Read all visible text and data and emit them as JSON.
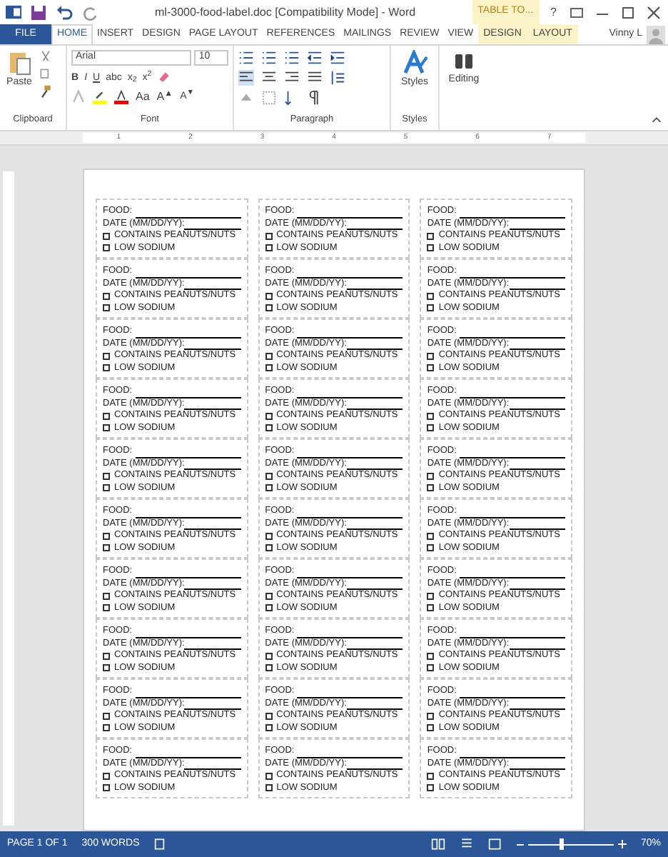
{
  "title_bar": {
    "title": "ml-3000-food-label.doc [Compatibility Mode] - Word",
    "contextual_group": "TABLE TO...",
    "help": "?"
  },
  "tabs": [
    {
      "label": "FILE",
      "kind": "file",
      "selected": false
    },
    {
      "label": "HOME",
      "kind": "normal",
      "selected": true
    },
    {
      "label": "INSERT",
      "kind": "normal",
      "selected": false
    },
    {
      "label": "DESIGN",
      "kind": "normal",
      "selected": false
    },
    {
      "label": "PAGE LAYOUT",
      "kind": "normal",
      "selected": false
    },
    {
      "label": "REFERENCES",
      "kind": "normal",
      "selected": false
    },
    {
      "label": "MAILINGS",
      "kind": "normal",
      "selected": false
    },
    {
      "label": "REVIEW",
      "kind": "normal",
      "selected": false
    },
    {
      "label": "VIEW",
      "kind": "normal",
      "selected": false
    },
    {
      "label": "DESIGN",
      "kind": "contextual",
      "selected": false
    },
    {
      "label": "LAYOUT",
      "kind": "contextual",
      "selected": false
    }
  ],
  "user": "Vinny L",
  "ribbon": {
    "paste": "Paste",
    "clipboard_label": "Clipboard",
    "font_name": "Arial",
    "font_size": "10",
    "font_buttons": [
      "B",
      "I",
      "U",
      "abc",
      "x$_{2}$",
      "x$^{2}$"
    ],
    "case_button": "Aa",
    "grow_button": "A$^{▲}$",
    "shrink_button": "A$^{▼}$",
    "font_label": "Font",
    "paragraph_label": "Paragraph",
    "styles": "Styles",
    "styles_label": "Styles",
    "editing": "Editing"
  },
  "ruler": [
    "1",
    "2",
    "3",
    "4",
    "5",
    "6",
    "7"
  ],
  "label_rows": [
    [
      {
        "food": "FOOD:",
        "date": "DATE (MM/DD/YY):",
        "options": [
          {
            "text": "CONTAINS PEANUTS/NUTS",
            "checked": false
          },
          {
            "text": "LOW SODIUM",
            "checked": false
          }
        ]
      },
      {
        "food": "FOOD:",
        "date": "DATE (MM/DD/YY):",
        "options": [
          {
            "text": "CONTAINS PEANUTS/NUTS",
            "checked": false
          },
          {
            "text": "LOW SODIUM",
            "checked": false
          }
        ]
      },
      {
        "food": "FOOD:",
        "date": "DATE (MM/DD/YY):",
        "options": [
          {
            "text": "CONTAINS PEANUTS/NUTS",
            "checked": false
          },
          {
            "text": "LOW SODIUM",
            "checked": false
          }
        ]
      }
    ],
    [
      {
        "food": "FOOD:",
        "date": "DATE (MM/DD/YY):",
        "options": [
          {
            "text": "CONTAINS PEANUTS/NUTS",
            "checked": false
          },
          {
            "text": "LOW SODIUM",
            "checked": false
          }
        ]
      },
      {
        "food": "FOOD:",
        "date": "DATE (MM/DD/YY):",
        "options": [
          {
            "text": "CONTAINS PEANUTS/NUTS",
            "checked": false
          },
          {
            "text": "LOW SODIUM",
            "checked": false
          }
        ]
      },
      {
        "food": "FOOD:",
        "date": "DATE (MM/DD/YY):",
        "options": [
          {
            "text": "CONTAINS PEANUTS/NUTS",
            "checked": false
          },
          {
            "text": "LOW SODIUM",
            "checked": false
          }
        ]
      }
    ],
    [
      {
        "food": "FOOD:",
        "date": "DATE (MM/DD/YY):",
        "options": [
          {
            "text": "CONTAINS PEANUTS/NUTS",
            "checked": false
          },
          {
            "text": "LOW SODIUM",
            "checked": false
          }
        ]
      },
      {
        "food": "FOOD:",
        "date": "DATE (MM/DD/YY):",
        "options": [
          {
            "text": "CONTAINS PEANUTS/NUTS",
            "checked": false
          },
          {
            "text": "LOW SODIUM",
            "checked": false
          }
        ]
      },
      {
        "food": "FOOD:",
        "date": "DATE (MM/DD/YY):",
        "options": [
          {
            "text": "CONTAINS PEANUTS/NUTS",
            "checked": false
          },
          {
            "text": "LOW SODIUM",
            "checked": false
          }
        ]
      }
    ],
    [
      {
        "food": "FOOD:",
        "date": "DATE (MM/DD/YY):",
        "options": [
          {
            "text": "CONTAINS PEANUTS/NUTS",
            "checked": false
          },
          {
            "text": "LOW SODIUM",
            "checked": false
          }
        ]
      },
      {
        "food": "FOOD:",
        "date": "DATE (MM/DD/YY):",
        "options": [
          {
            "text": "CONTAINS PEANUTS/NUTS",
            "checked": false
          },
          {
            "text": "LOW SODIUM",
            "checked": false
          }
        ]
      },
      {
        "food": "FOOD:",
        "date": "DATE (MM/DD/YY):",
        "options": [
          {
            "text": "CONTAINS PEANUTS/NUTS",
            "checked": false
          },
          {
            "text": "LOW SODIUM",
            "checked": false
          }
        ]
      }
    ],
    [
      {
        "food": "FOOD:",
        "date": "DATE (MM/DD/YY):",
        "options": [
          {
            "text": "CONTAINS PEANUTS/NUTS",
            "checked": false
          },
          {
            "text": "LOW SODIUM",
            "checked": false
          }
        ]
      },
      {
        "food": "FOOD:",
        "date": "DATE (MM/DD/YY):",
        "options": [
          {
            "text": "CONTAINS PEANUTS/NUTS",
            "checked": false
          },
          {
            "text": "LOW SODIUM",
            "checked": false
          }
        ]
      },
      {
        "food": "FOOD:",
        "date": "DATE (MM/DD/YY):",
        "options": [
          {
            "text": "CONTAINS PEANUTS/NUTS",
            "checked": false
          },
          {
            "text": "LOW SODIUM",
            "checked": false
          }
        ]
      }
    ],
    [
      {
        "food": "FOOD:",
        "date": "DATE (MM/DD/YY):",
        "options": [
          {
            "text": "CONTAINS PEANUTS/NUTS",
            "checked": false
          },
          {
            "text": "LOW SODIUM",
            "checked": false
          }
        ]
      },
      {
        "food": "FOOD:",
        "date": "DATE (MM/DD/YY):",
        "options": [
          {
            "text": "CONTAINS PEANUTS/NUTS",
            "checked": false
          },
          {
            "text": "LOW SODIUM",
            "checked": false
          }
        ]
      },
      {
        "food": "FOOD:",
        "date": "DATE (MM/DD/YY):",
        "options": [
          {
            "text": "CONTAINS PEANUTS/NUTS",
            "checked": false
          },
          {
            "text": "LOW SODIUM",
            "checked": false
          }
        ]
      }
    ],
    [
      {
        "food": "FOOD:",
        "date": "DATE (MM/DD/YY):",
        "options": [
          {
            "text": "CONTAINS PEANUTS/NUTS",
            "checked": false
          },
          {
            "text": "LOW SODIUM",
            "checked": false
          }
        ]
      },
      {
        "food": "FOOD:",
        "date": "DATE (MM/DD/YY):",
        "options": [
          {
            "text": "CONTAINS PEANUTS/NUTS",
            "checked": false
          },
          {
            "text": "LOW SODIUM",
            "checked": false
          }
        ]
      },
      {
        "food": "FOOD:",
        "date": "DATE (MM/DD/YY):",
        "options": [
          {
            "text": "CONTAINS PEANUTS/NUTS",
            "checked": false
          },
          {
            "text": "LOW SODIUM",
            "checked": false
          }
        ]
      }
    ],
    [
      {
        "food": "FOOD:",
        "date": "DATE (MM/DD/YY):",
        "options": [
          {
            "text": "CONTAINS PEANUTS/NUTS",
            "checked": false
          },
          {
            "text": "LOW SODIUM",
            "checked": false
          }
        ]
      },
      {
        "food": "FOOD:",
        "date": "DATE (MM/DD/YY):",
        "options": [
          {
            "text": "CONTAINS PEANUTS/NUTS",
            "checked": false
          },
          {
            "text": "LOW SODIUM",
            "checked": false
          }
        ]
      },
      {
        "food": "FOOD:",
        "date": "DATE (MM/DD/YY):",
        "options": [
          {
            "text": "CONTAINS PEANUTS/NUTS",
            "checked": false
          },
          {
            "text": "LOW SODIUM",
            "checked": false
          }
        ]
      }
    ],
    [
      {
        "food": "FOOD:",
        "date": "DATE (MM/DD/YY):",
        "options": [
          {
            "text": "CONTAINS PEANUTS/NUTS",
            "checked": false
          },
          {
            "text": "LOW SODIUM",
            "checked": false
          }
        ]
      },
      {
        "food": "FOOD:",
        "date": "DATE (MM/DD/YY):",
        "options": [
          {
            "text": "CONTAINS PEANUTS/NUTS",
            "checked": false
          },
          {
            "text": "LOW SODIUM",
            "checked": false
          }
        ]
      },
      {
        "food": "FOOD:",
        "date": "DATE (MM/DD/YY):",
        "options": [
          {
            "text": "CONTAINS PEANUTS/NUTS",
            "checked": false
          },
          {
            "text": "LOW SODIUM",
            "checked": false
          }
        ]
      }
    ],
    [
      {
        "food": "FOOD:",
        "date": "DATE (MM/DD/YY):",
        "options": [
          {
            "text": "CONTAINS PEANUTS/NUTS",
            "checked": false
          },
          {
            "text": "LOW SODIUM",
            "checked": false
          }
        ]
      },
      {
        "food": "FOOD:",
        "date": "DATE (MM/DD/YY):",
        "options": [
          {
            "text": "CONTAINS PEANUTS/NUTS",
            "checked": false
          },
          {
            "text": "LOW SODIUM",
            "checked": false
          }
        ]
      },
      {
        "food": "FOOD:",
        "date": "DATE (MM/DD/YY):",
        "options": [
          {
            "text": "CONTAINS PEANUTS/NUTS",
            "checked": false
          },
          {
            "text": "LOW SODIUM",
            "checked": false
          }
        ]
      }
    ]
  ],
  "status_bar": {
    "page": "PAGE 1 OF 1",
    "words": "300 WORDS",
    "zoom": {
      "level": 0.4,
      "reading": "70%"
    }
  }
}
